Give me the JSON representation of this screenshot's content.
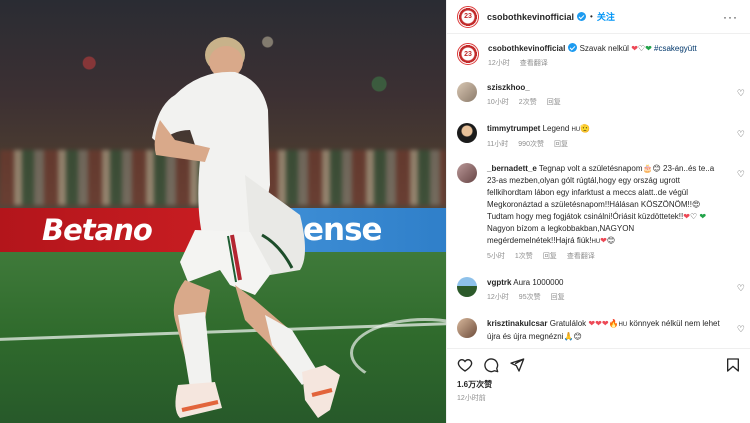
{
  "post": {
    "username": "csobothkevinofficial",
    "follow_label": "关注",
    "more_label": "···",
    "avatar_text": "23"
  },
  "photo": {
    "ad_left": "Betano",
    "ad_right": "ense"
  },
  "caption": {
    "username": "csobothkevinofficial",
    "text_start": "Szavak nelkül",
    "hashtag": "#csakegyütt",
    "time": "12小时",
    "translate": "查看翻译"
  },
  "comments": [
    {
      "user": "sziszkhoo_",
      "text": "",
      "time": "10小时",
      "likes": "2次赞",
      "reply": "回复"
    },
    {
      "user": "timmytrumpet",
      "text": "Legend",
      "suffix": "HU",
      "time": "11小时",
      "likes": "990次赞",
      "reply": "回复"
    },
    {
      "user": "_bernadett_e",
      "text": "Tegnap volt a születésnapom",
      "text2": "23-án..és te..a 23-as mezben,olyan gólt rúgtál,hogy egy ország ugrott fellkihordtam lábon egy infarktust a meccs alatt..de végül Megkoronáztad a születésnapom!!Hálásan KÖSZÖNÖM!!",
      "text3": "Tudtam hogy meg fogjátok csinálni!Óriásit küzdöttetek!!",
      "text4": "Nagyon bízom a legkobbakban,NAGYON megérdemelnétek!!Hajrá fiúk!",
      "suffix": "HU",
      "time": "5小时",
      "likes": "1次赞",
      "reply": "回复",
      "translate": "查看翻译"
    },
    {
      "user": "vgptrk",
      "text": "Aura 1000000",
      "time": "12小时",
      "likes": "95次赞",
      "reply": "回复"
    },
    {
      "user": "krisztinakulcsar",
      "text": "Gratulálok",
      "suffix": "HU",
      "text2": "könnyek nélkül nem lehet újra és újra megnézni",
      "time": "",
      "likes": "",
      "reply": ""
    }
  ],
  "footer": {
    "likes": "1.6万次赞",
    "time": "12小时前"
  },
  "colors": {
    "accent": "#0095f6",
    "verified": "#1d9bf0",
    "heart": "#ed4956"
  }
}
